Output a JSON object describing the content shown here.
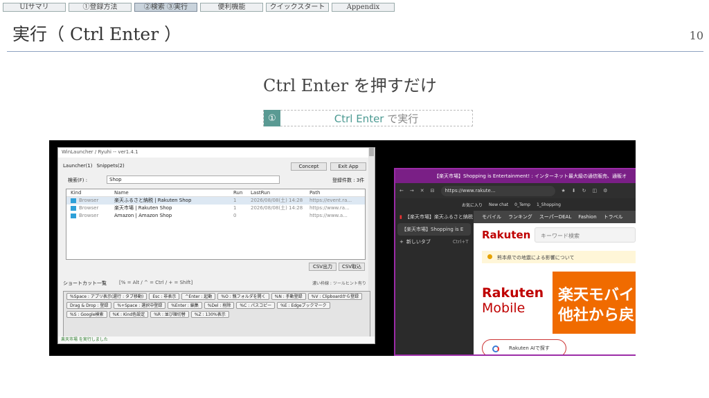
{
  "nav_tabs": [
    {
      "label": "UIサマリ"
    },
    {
      "label": "①登録方法"
    },
    {
      "label": "②検索 ③実行"
    },
    {
      "label": "便利機能"
    },
    {
      "label": "クイックスタート"
    },
    {
      "label": "Appendix"
    }
  ],
  "active_tab": 2,
  "page_title": "実行（ Ctrl Enter ）",
  "page_number": "10",
  "heading": "Ctrl Enter を押すだけ",
  "note": {
    "icon": "①",
    "key": "Ctrl Enter",
    "text": " で実行"
  },
  "launcher": {
    "title": "WinLauncher / Ryuhi -- ver1.4.1",
    "tabs": [
      "Launcher(1)",
      "Snippets(2)"
    ],
    "concept_button": "Concept",
    "exit_button": "Exit App",
    "search_label": "検索(F) :",
    "search_value": "Shop",
    "count_label": "登録件数 : 3件",
    "columns": [
      "Kind",
      "Name",
      "Run",
      "LastRun",
      "Path"
    ],
    "rows": [
      {
        "kind": "Browser",
        "name": "楽天ふるさと納税 | Rakuten Shop",
        "run": "1",
        "lastrun": "2026/08/08(土) 14:28",
        "path": "https://event.ra..."
      },
      {
        "kind": "Browser",
        "name": "楽天市場 | Rakuten Shop",
        "run": "1",
        "lastrun": "2026/08/08(土) 14:28",
        "path": "https://www.ra..."
      },
      {
        "kind": "Browser",
        "name": "Amazon | Amazon Shop",
        "run": "0",
        "lastrun": "",
        "path": "https://www.a..."
      }
    ],
    "csv_out": "CSV出力",
    "csv_in": "CSV取込",
    "shortcut_title": "ショートカット一覧",
    "shortcut_legend": "[% = Alt / ^ = Ctrl / + = Shift]",
    "shortcut_hint": "濃い枠線 : ツールヒント有り",
    "shortcuts": [
      "%Space : アプリ表示(還行 : タブ移動)",
      "Esc : 非表示",
      "^Enter : 起動",
      "%O : 親フォルダを開く",
      "%N : 手動登録",
      "%V : Clipboardから登録",
      "Drag & Drop : 登録",
      "%+Space : 選択中登録",
      "%Enter : 編集",
      "%Del : 削除",
      "%C : パスコピー",
      "%E : Edgeブックマーク",
      "%S : Google検索",
      "%K : Kind色設定",
      "%R : 並び順切替",
      "%Z : 130%表示"
    ],
    "status": "楽天市場 を実行しました"
  },
  "browser": {
    "tab_title": "【楽天市場】Shopping is Entertainment! : インターネット最大級の通信販売、通販オ",
    "url": "https://www.rakute...",
    "bookmarks": [
      "お気に入り",
      "New chat",
      "0_Temp",
      "1_Shopping"
    ],
    "side_tabs": [
      "【楽天市場】楽天ふるさと納税",
      "【楽天市場】Shopping is E",
      "新しいタブ"
    ],
    "new_tab_shortcut": "Ctrl+T",
    "rnav": [
      "モバイル",
      "ランキング",
      "スーパーDEAL",
      "Fashion",
      "トラベル"
    ],
    "logo": "Rakuten",
    "search_placeholder": "キーワード検索",
    "alert": "熊本県での地震による影響について",
    "banner_left": [
      "Rakuten",
      "Mobile"
    ],
    "banner_right": [
      "楽天モバイ",
      "他社から戻っ"
    ],
    "ai_button": "Rakuten AIで探す"
  }
}
